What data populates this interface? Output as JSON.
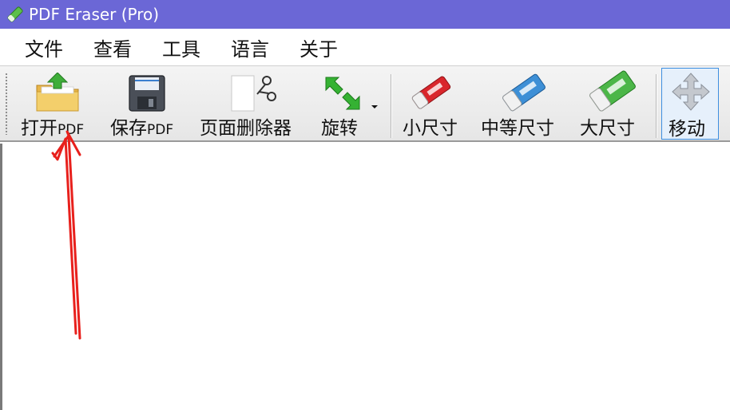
{
  "window": {
    "title": "PDF Eraser (Pro)"
  },
  "menu": {
    "items": [
      "文件",
      "查看",
      "工具",
      "语言",
      "关于"
    ]
  },
  "toolbar": {
    "open_label": "打开",
    "open_suffix": "PDF",
    "save_label": "保存",
    "save_suffix": "PDF",
    "page_remover_label": "页面删除器",
    "rotate_label": "旋转",
    "small_label": "小尺寸",
    "medium_label": "中等尺寸",
    "large_label": "大尺寸",
    "move_label": "移动"
  },
  "colors": {
    "titlebar": "#6b67d6",
    "annotation_arrow": "#e8201c",
    "eraser_red": "#d9262c",
    "eraser_blue": "#3d8fd6",
    "eraser_green": "#4cb648"
  }
}
